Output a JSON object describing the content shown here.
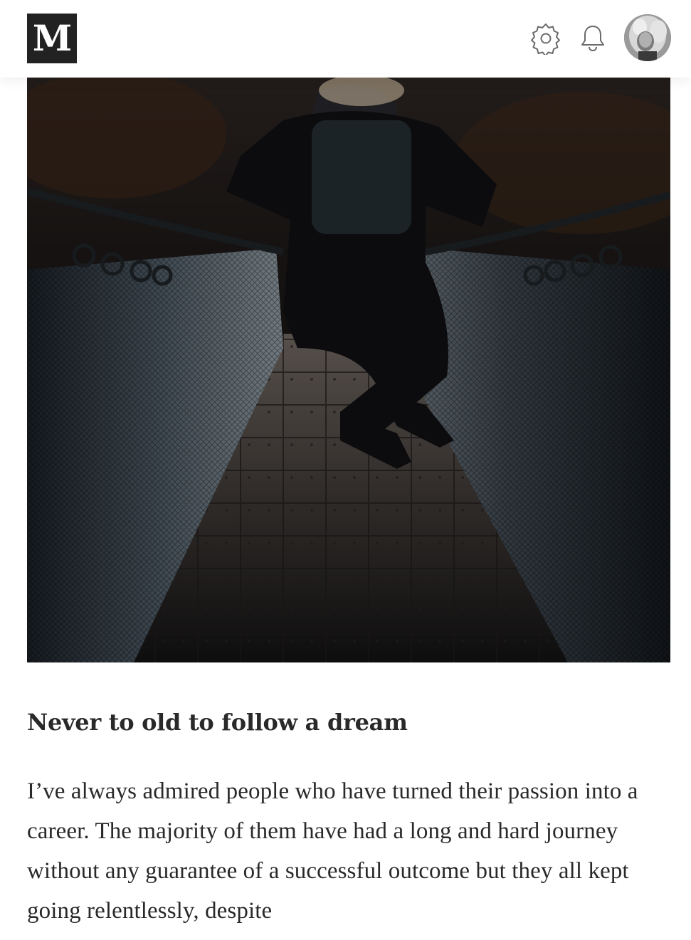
{
  "header": {
    "logo_text": "M",
    "icons": [
      "settings-gear-icon",
      "notification-bell-icon",
      "user-avatar"
    ]
  },
  "hero_image": {
    "description_icon": "photo-person-jumping-on-suspension-bridge"
  },
  "article": {
    "subtitle": "Never to old to follow a dream",
    "paragraph": "I’ve always admired people who have turned their passion into a career. The majority of them have had a long and hard journey without any guarantee of a successful outcome but they all kept going relentlessly, despite"
  },
  "colors": {
    "text": "#292929",
    "logo_bg": "#222222",
    "background": "#ffffff"
  }
}
